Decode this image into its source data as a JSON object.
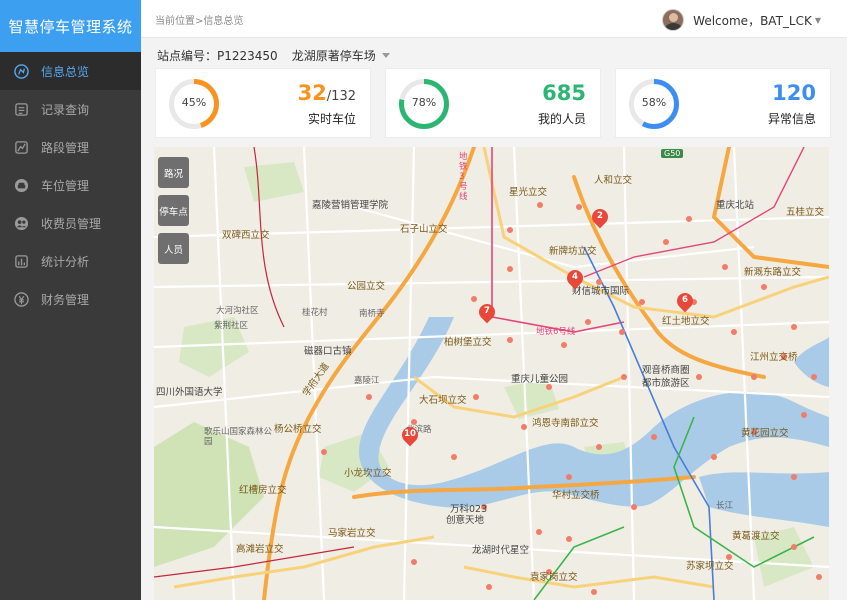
{
  "app": {
    "title": "智慧停车管理系统"
  },
  "sidebar": {
    "items": [
      {
        "label": "信息总览",
        "icon": "dashboard-icon"
      },
      {
        "label": "记录查询",
        "icon": "record-icon"
      },
      {
        "label": "路段管理",
        "icon": "road-icon"
      },
      {
        "label": "车位管理",
        "icon": "car-icon"
      },
      {
        "label": "收费员管理",
        "icon": "users-icon"
      },
      {
        "label": "统计分析",
        "icon": "stats-icon"
      },
      {
        "label": "财务管理",
        "icon": "finance-icon"
      }
    ]
  },
  "header": {
    "breadcrumb": "当前位置>信息总览",
    "welcome": "Welcome，BAT_LCK"
  },
  "station": {
    "label": "站点编号：P1223450",
    "selected": "龙湖原著停车场"
  },
  "cards": [
    {
      "percent": "45%",
      "ratio": 0.45,
      "value": "32",
      "total": "/132",
      "label": "实时车位",
      "color": "#f7931e"
    },
    {
      "percent": "78%",
      "ratio": 0.78,
      "value": "685",
      "total": "",
      "label": "我的人员",
      "color": "#2bb673"
    },
    {
      "percent": "58%",
      "ratio": 0.58,
      "value": "120",
      "total": "",
      "label": "异常信息",
      "color": "#3d8ef0"
    }
  ],
  "map": {
    "tools": [
      "路况",
      "停车点",
      "人员"
    ],
    "labels": [
      "嘉陵营销管理学院",
      "双碑西立交",
      "石子山立交",
      "星光立交",
      "人和立交",
      "重庆北站",
      "五桂立交",
      "新牌坊立交",
      "财信城市国际",
      "新溉东路立交",
      "红土地立交",
      "公园立交",
      "南桥寺",
      "桂花村",
      "大河沟社区",
      "紫荆社区",
      "柏树堡立交",
      "磁器口古镇",
      "嘉陵江",
      "四川外国语大学",
      "重庆儿童公园",
      "观音桥商圈",
      "都市旅游区",
      "江州立交桥",
      "大石坝立交",
      "鸿恩寺南部立交",
      "歌乐山国家森林公园",
      "杨公桥立交",
      "小龙坎立交",
      "黄花园立交",
      "北滨路",
      "红槽房立交",
      "华村立交桥",
      "万科023",
      "创意天地",
      "马家岩立交",
      "龙湖时代星空",
      "高滩岩立交",
      "袁家岗立交",
      "长江",
      "黄葛渡立交",
      "苏家坝立交",
      "地铁6号线",
      "地铁3号线",
      "G50",
      "学府大道"
    ],
    "pins": [
      "2",
      "4",
      "6",
      "7",
      "10"
    ]
  }
}
